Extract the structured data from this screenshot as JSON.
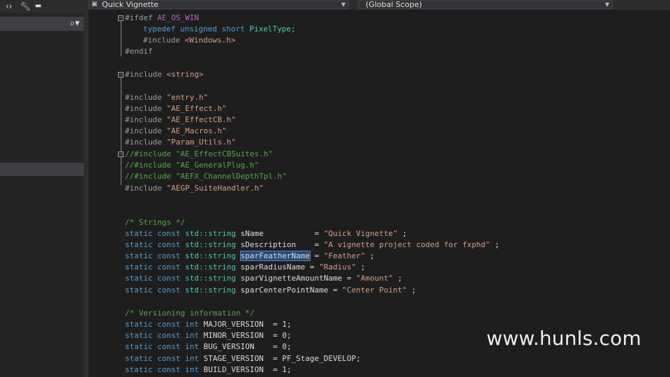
{
  "left_toolbar": {
    "code_icon": "code-brackets-icon",
    "wrench_icon": "wrench-icon",
    "pin_icon": "pin-icon"
  },
  "left_panel": {
    "search_icon": "search-icon",
    "tree_item_text": ")"
  },
  "nav": {
    "file_combo": "Quick Vignette",
    "scope_combo": "(Global Scope)"
  },
  "code": {
    "l1_pp": "#ifdef",
    "l1_mac": "AE_OS_WIN",
    "l2_kw": "typedef unsigned short",
    "l2_ty": "PixelType;",
    "l3_pp": "#include",
    "l3_str": "<Windows.h>",
    "l4": "#endif",
    "l5_pp": "#include",
    "l5_str": "<string>",
    "inc1_pp": "#include",
    "inc1_str": "\"entry.h\"",
    "inc2_pp": "#include",
    "inc2_str": "\"AE_Effect.h\"",
    "inc3_pp": "#include",
    "inc3_str": "\"AE_EffectCB.h\"",
    "inc4_pp": "#include",
    "inc4_str": "\"AE_Macros.h\"",
    "inc5_pp": "#include",
    "inc5_str": "\"Param_Utils.h\"",
    "c1": "//#include \"AE_EffectCBSuites.h\"",
    "c2": "//#include \"AE_GeneralPlug.h\"",
    "c3": "//#include \"AEFX_ChannelDepthTpl.h\"",
    "inc6_pp": "#include",
    "inc6_str": "\"AEGP_SuiteHandler.h\"",
    "strings_comment": "/* Strings */",
    "static_const": "static const",
    "std_string": "std::string",
    "s1_name": "sName           =",
    "s1_val": "\"Quick Vignette\"",
    "s2_name": "sDescription    =",
    "s2_val": "\"A vignette project coded for fxphd\"",
    "s3_name": "sparFeatherName",
    "s3_eq": "=",
    "s3_val": "\"Feather\"",
    "s4_name": "sparRadiusName =",
    "s4_val": "\"Radius\"",
    "s5_name": "sparVignetteAmountName =",
    "s5_val": "\"Amount\"",
    "s6_name": "sparCenterPointName =",
    "s6_val": "\"Center Point\"",
    "semi": ";",
    "version_comment": "/* Versioning information */",
    "int_kw": "int",
    "v1": "MAJOR_VERSION  = 1;",
    "v2": "MINOR_VERSION  = 0;",
    "v3": "BUG_VERSION    = 0;",
    "v4": "STAGE_VERSION  = PF_Stage_DEVELOP;",
    "v5": "BUILD_VERSION  = 1;"
  },
  "watermark": "www.hunls.com"
}
